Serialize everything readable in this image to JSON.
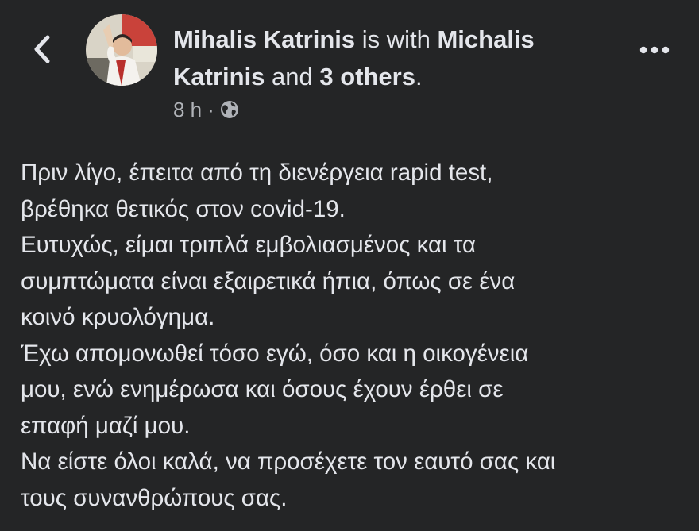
{
  "header": {
    "author": "Mihalis Katrinis",
    "with_text": " is with ",
    "tagged_first": "Michalis Katrinis",
    "and_text": " and ",
    "others": "3 others",
    "period": ".",
    "time": "8 h",
    "separator": "·",
    "privacy_icon": "globe-icon",
    "back_icon": "chevron-left-icon",
    "more_icon": "more-horizontal-icon"
  },
  "post": {
    "lines": [
      "Πριν λίγο, έπειτα από τη διενέργεια rapid test,",
      "βρέθηκα θετικός στον covid-19.",
      "Ευτυχώς, είμαι τριπλά εμβολιασμένος και τα",
      "συμπτώματα είναι εξαιρετικά ήπια, όπως σε ένα",
      "κοινό κρυολόγημα.",
      "Έχω απομονωθεί τόσο εγώ, όσο και η οικογένεια",
      "μου, ενώ ενημέρωσα και όσους έχουν έρθει σε",
      "επαφή μαζί μου.",
      "Να είστε όλοι καλά, να προσέχετε τον εαυτό σας και",
      "τους συνανθρώπους σας."
    ]
  },
  "colors": {
    "background": "#242526",
    "text_primary": "#e4e6eb",
    "text_secondary": "#b0b3b8"
  }
}
